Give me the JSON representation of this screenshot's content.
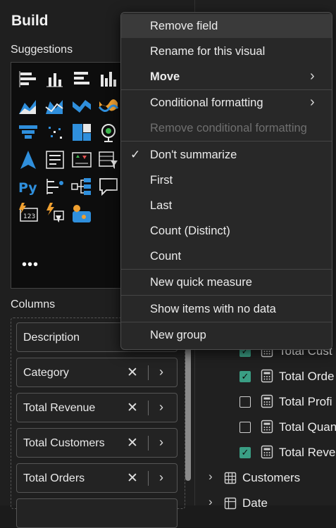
{
  "build": {
    "title": "Build",
    "suggestions_label": "Suggestions",
    "more": "•••"
  },
  "visual_icons": [
    "stacked-bar-chart-icon",
    "stacked-column-chart-icon",
    "clustered-bar-chart-icon",
    "clustered-column-chart-icon",
    "line-chart-icon",
    "area-chart-icon",
    "stacked-area-chart-icon",
    "ribbon-chart-icon",
    "waterfall-chart-icon",
    "bar-line-combo-icon",
    "funnel-chart-icon",
    "scatter-chart-icon",
    "treemap-icon",
    "map-icon",
    "filled-map-icon",
    "azure-map-icon",
    "card-icon",
    "kpi-icon",
    "slicer-icon",
    "table-icon",
    "python-visual-icon",
    "key-influencers-icon",
    "decomposition-tree-icon",
    "qa-icon",
    "paginated-report-icon",
    "smart-narrative-icon",
    "power-apps-icon",
    "power-automate-icon"
  ],
  "columns": {
    "label": "Columns",
    "fields": [
      "Description",
      "Category",
      "Total Revenue",
      "Total Customers",
      "Total Orders"
    ]
  },
  "context_menu": {
    "items": [
      {
        "label": "Remove field",
        "highlighted": true
      },
      {
        "label": "Rename for this visual"
      },
      {
        "label": "Move",
        "submenu": true
      },
      {
        "label": "Conditional formatting",
        "submenu": true
      },
      {
        "label": "Remove conditional formatting",
        "disabled": true
      },
      {
        "label": "Don't summarize",
        "checked": true
      },
      {
        "label": "First"
      },
      {
        "label": "Last"
      },
      {
        "label": "Count (Distinct)"
      },
      {
        "label": "Count"
      },
      {
        "label": "New quick measure"
      },
      {
        "label": "Show items with no data"
      },
      {
        "label": "New group"
      }
    ]
  },
  "data_fields": [
    {
      "label": "Total Cust",
      "checked": true
    },
    {
      "label": "Total Orde",
      "checked": true
    },
    {
      "label": "Total Profi",
      "checked": false
    },
    {
      "label": "Total Quan",
      "checked": false
    },
    {
      "label": "Total Reve",
      "checked": true
    }
  ],
  "tables": [
    "Customers",
    "Date"
  ],
  "colors": {
    "accent_green": "#3a9e84",
    "chart_blue": "#2f8fdc",
    "chart_orange": "#f0a030"
  }
}
